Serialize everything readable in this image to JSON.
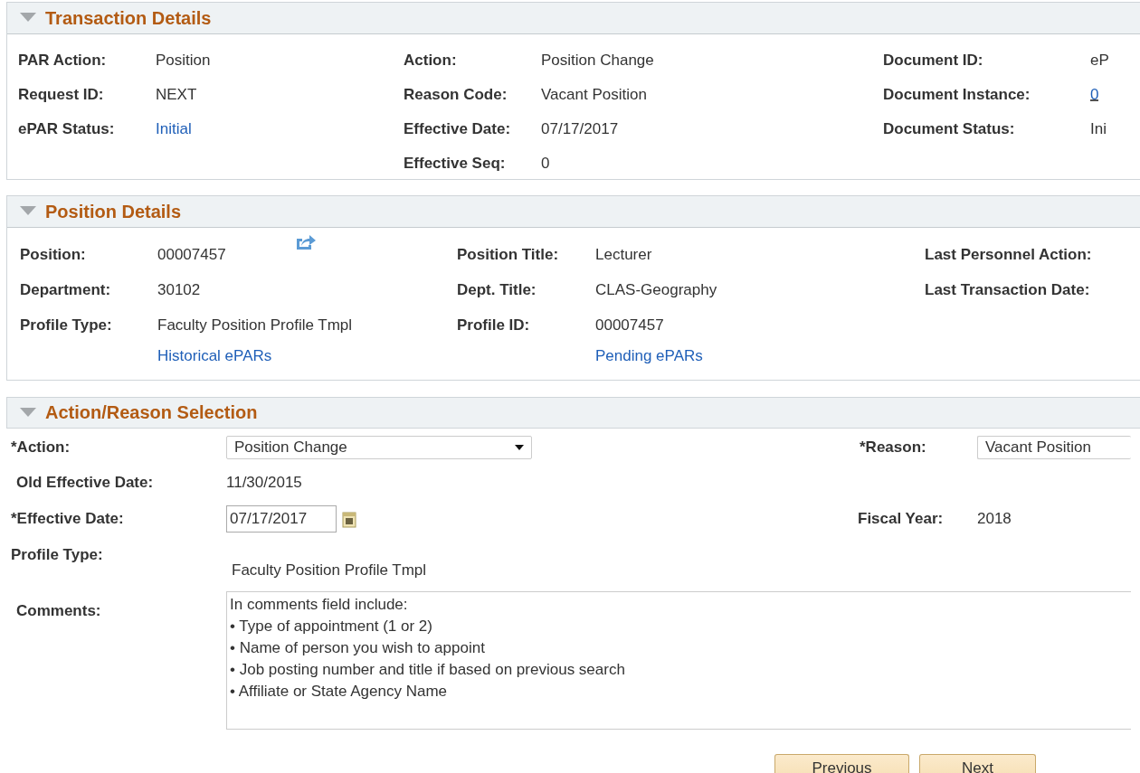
{
  "transaction_details": {
    "title": "Transaction Details",
    "expanded": true,
    "columns": [
      [
        {
          "label": "PAR Action:",
          "value": "Position",
          "kind": "text"
        },
        {
          "label": "Request ID:",
          "value": "NEXT",
          "kind": "text"
        },
        {
          "label": "ePAR Status:",
          "value": "Initial",
          "kind": "link"
        }
      ],
      [
        {
          "label": "Action:",
          "value": "Position Change",
          "kind": "text"
        },
        {
          "label": "Reason Code:",
          "value": "Vacant Position",
          "kind": "text"
        },
        {
          "label": "Effective Date:",
          "value": "07/17/2017",
          "kind": "text"
        },
        {
          "label": "Effective Seq:",
          "value": "0",
          "kind": "text"
        }
      ],
      [
        {
          "label": "Document ID:",
          "value": "eP",
          "kind": "text"
        },
        {
          "label": "Document Instance:",
          "value": "0",
          "kind": "dotted_link"
        },
        {
          "label": "Document Status:",
          "value": "Ini",
          "kind": "text"
        }
      ]
    ]
  },
  "position_details": {
    "title": "Position Details",
    "expanded": true,
    "columns": [
      [
        {
          "label": "Position:",
          "value": "00007457",
          "kind": "text_with_icon"
        },
        {
          "label": "Department:",
          "value": "30102",
          "kind": "text"
        },
        {
          "label": "Profile Type:",
          "value": "Faculty Position Profile Tmpl",
          "kind": "text"
        },
        {
          "value": "Historical ePARs",
          "kind": "link"
        }
      ],
      [
        {
          "label": "Position Title:",
          "value": "Lecturer",
          "kind": "text"
        },
        {
          "label": "Dept. Title:",
          "value": "CLAS-Geography",
          "kind": "text"
        },
        {
          "label": "Profile ID:",
          "value": "00007457",
          "kind": "text"
        },
        {
          "value": "Pending ePARs",
          "kind": "link"
        }
      ],
      [
        {
          "label": "Last Personnel Action:"
        },
        {
          "label": "Last Transaction Date:"
        }
      ]
    ]
  },
  "action_reason_selection": {
    "title": "Action/Reason Selection",
    "expanded": true,
    "action": {
      "label": "*Action:",
      "value": "Position Change"
    },
    "reason": {
      "label": "*Reason:",
      "value": "Vacant Position"
    },
    "old_effective_date": {
      "label": "Old Effective Date:",
      "value": "11/30/2015"
    },
    "effective_date": {
      "label": "*Effective Date:",
      "value": "07/17/2017"
    },
    "fiscal_year": {
      "label": "Fiscal Year:",
      "value": "2018"
    },
    "profile_type": {
      "label": "Profile Type:",
      "value": "Faculty Position Profile Tmpl"
    },
    "comments": {
      "label": "Comments:",
      "value": "In comments field include:\n• Type of appointment (1 or 2)\n• Name of person you wish to appoint\n• Job posting number and title if based on previous search\n• Affiliate or State Agency Name"
    }
  },
  "buttons": [
    "Previous",
    "Next"
  ]
}
